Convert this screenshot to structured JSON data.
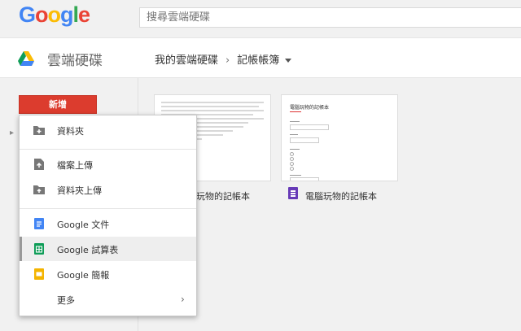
{
  "header": {
    "logo_letters": [
      "G",
      "o",
      "o",
      "g",
      "l",
      "e"
    ],
    "search_placeholder": "搜尋雲端硬碟"
  },
  "appbar": {
    "app_title": "雲端硬碟",
    "breadcrumb_root": "我的雲端硬碟",
    "breadcrumb_separator": "›",
    "breadcrumb_current": "記帳帳簿"
  },
  "sidebar": {
    "new_button_label": "新增"
  },
  "new_menu": {
    "items": [
      {
        "label": "資料夾",
        "icon": "new-folder-icon"
      },
      {
        "label": "檔案上傳",
        "icon": "file-upload-icon"
      },
      {
        "label": "資料夾上傳",
        "icon": "folder-upload-icon"
      },
      {
        "label": "Google 文件",
        "icon": "google-docs-icon"
      },
      {
        "label": "Google 試算表",
        "icon": "google-sheets-icon"
      },
      {
        "label": "Google 簡報",
        "icon": "google-slides-icon"
      },
      {
        "label": "更多",
        "icon": "chevron-right-icon"
      }
    ],
    "highlighted": "Google 試算表"
  },
  "files": [
    {
      "label": "玩物的記帳本",
      "type": "spreadsheet"
    },
    {
      "label": "電腦玩物的記帳本",
      "type": "form",
      "preview_title": "電腦玩物的記帳本"
    }
  ],
  "colors": {
    "new_button": "#dc3c2e",
    "docs": "#4285f4",
    "sheets": "#0f9d58",
    "slides": "#f4b400",
    "forms": "#673ab7"
  }
}
